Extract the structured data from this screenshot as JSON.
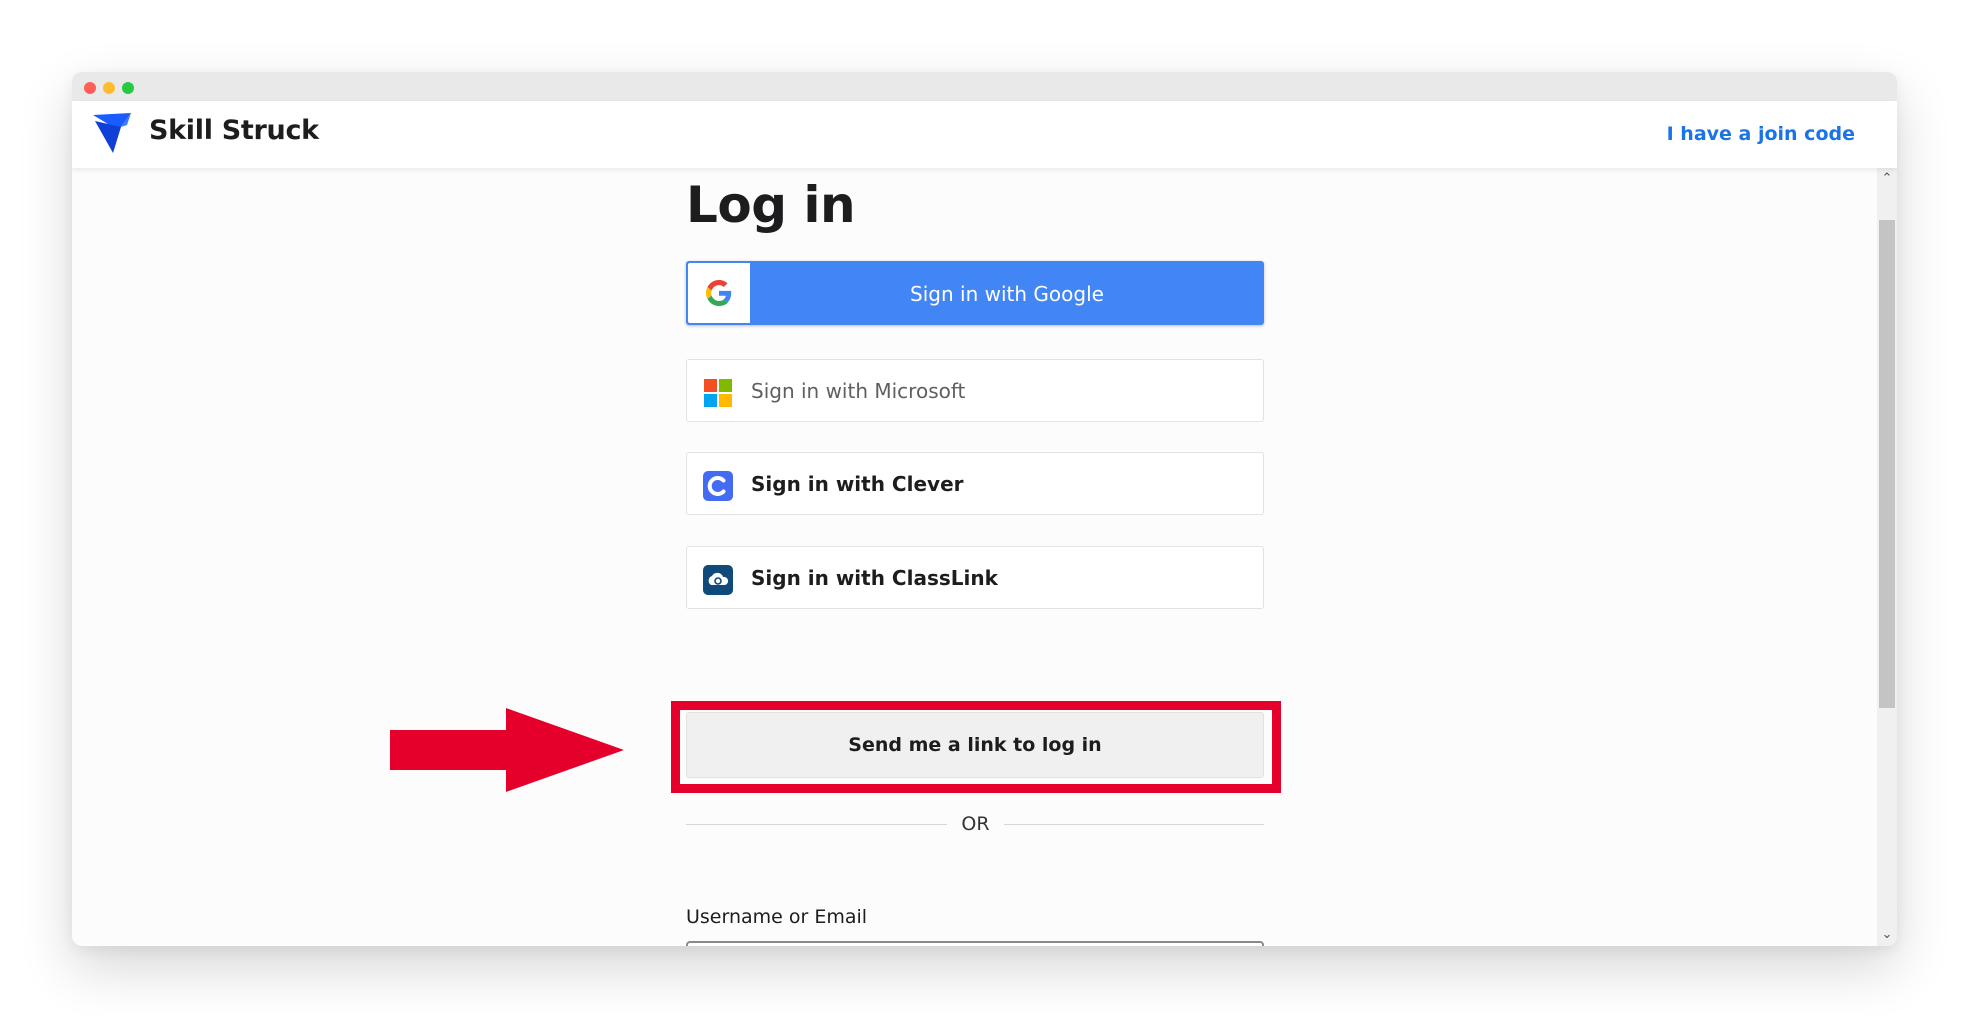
{
  "header": {
    "brand": "Skill Struck",
    "join_code_link": "I have a join code"
  },
  "main": {
    "title": "Log in",
    "google_button": "Sign in with Google",
    "microsoft_button": "Sign in with Microsoft",
    "clever_button": "Sign in with Clever",
    "classlink_button": "Sign in with ClassLink",
    "magic_link_button": "Send me a link to log in",
    "divider_text": "OR",
    "username_label": "Username or Email",
    "username_value": ""
  },
  "icons": {
    "logo": "skill-struck-logo-icon",
    "google": "google-icon",
    "microsoft": "microsoft-icon",
    "clever": "clever-icon",
    "classlink": "classlink-icon",
    "annotation_arrow": "red-arrow-annotation"
  },
  "colors": {
    "brand_blue": "#1a5cff",
    "link_blue": "#1a73e8",
    "google_blue": "#4285f4",
    "highlight_red": "#e4002b"
  }
}
